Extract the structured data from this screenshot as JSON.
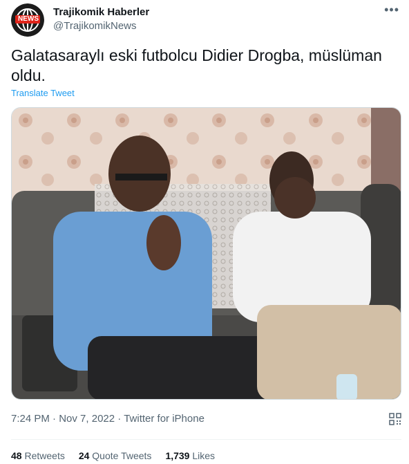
{
  "account": {
    "name": "Trajikomik Haberler",
    "handle": "@TrajikomikNews",
    "avatar_text": "NEWS"
  },
  "tweet": {
    "text": "Galatasaraylı eski futbolcu Didier Drogba, müslüman oldu.",
    "translate_label": "Translate Tweet",
    "time": "7:24 PM",
    "date": "Nov 7, 2022",
    "source": "Twitter for iPhone"
  },
  "stats": {
    "retweets_count": "48",
    "retweets_label": "Retweets",
    "quotes_count": "24",
    "quotes_label": "Quote Tweets",
    "likes_count": "1,739",
    "likes_label": "Likes"
  },
  "icons": {
    "more": "more-options-icon",
    "qr": "qr-code-icon"
  },
  "colors": {
    "link": "#1d9bf0",
    "secondary_text": "#536471",
    "avatar_badge": "#e1251b"
  }
}
